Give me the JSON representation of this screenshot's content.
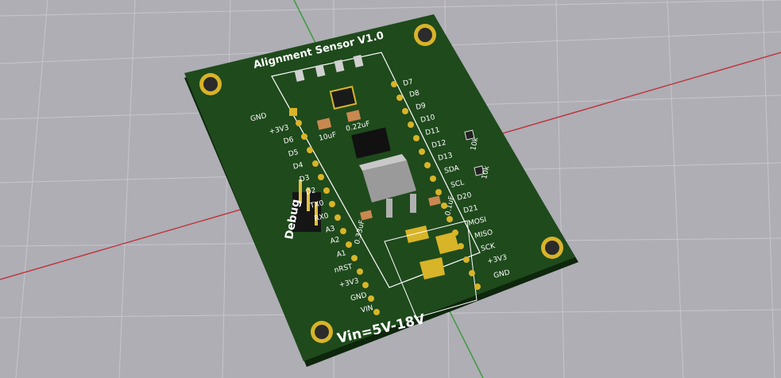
{
  "board": {
    "title": "Alignment Sensor V1.0",
    "vin_label": "Vin=5V-18V",
    "debug_label": "Debug",
    "capacitors": {
      "c1": "10uF",
      "c2": "0.22uF",
      "c3": "0.33uF",
      "c4": "0.1uF"
    },
    "resistors": {
      "r1": "10k",
      "r2": "10k"
    },
    "left_pins": [
      "GND",
      "+3V3",
      "D6",
      "D5",
      "D4",
      "D3",
      "D2",
      "TX0",
      "RX0",
      "A3",
      "A2",
      "A1",
      "nRST",
      "+3V3",
      "GND",
      "VIN"
    ],
    "right_pins": [
      "D7",
      "D8",
      "D9",
      "D10",
      "D11",
      "D12",
      "D13",
      "SDA",
      "SCL",
      "D20",
      "D21",
      "MOSI",
      "MISO",
      "SCK",
      "+3V3",
      "GND"
    ]
  },
  "colors": {
    "background": "#aeaeb4",
    "grid": "#c4c4ca",
    "pcb": "#1f4a1c",
    "pcb_edge": "#2c5a26",
    "silkscreen": "#ffffff",
    "gold": "#d8b428",
    "axis_x": "#c0303a",
    "axis_y": "#3a9a3a"
  }
}
